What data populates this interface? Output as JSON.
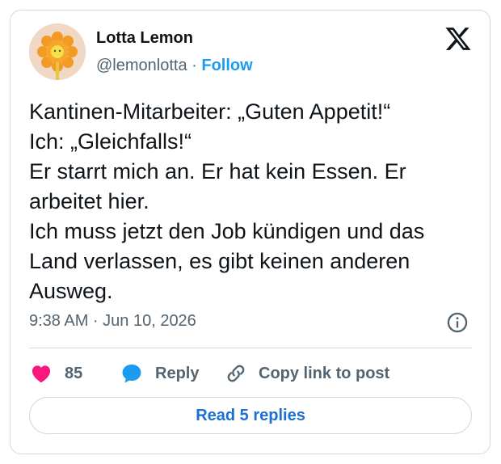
{
  "author": {
    "name": "Lotta Lemon",
    "handle": "@lemonlotta",
    "separator": "·",
    "follow_label": "Follow",
    "avatar_icon": "sun-flower-avatar"
  },
  "platform_icon": "x-logo-icon",
  "post": {
    "lines": [
      "Kantinen-Mitarbeiter: „Guten Appetit!“",
      "Ich: „Gleichfalls!“",
      "Er starrt mich an. Er hat kein Essen. Er",
      "arbeitet hier.",
      "Ich muss jetzt den Job kündigen und das",
      "Land verlassen, es gibt keinen anderen",
      "Ausweg."
    ],
    "timestamp": "9:38 AM · Jun 10, 2026",
    "info_icon": "info-icon"
  },
  "actions": {
    "like_count": "85",
    "reply_label": "Reply",
    "copy_label": "Copy link to post"
  },
  "read_replies_label": "Read 5 replies",
  "colors": {
    "accent": "#1d9bf0",
    "like": "#f91880",
    "reply_icon": "#1d9bf0",
    "muted_text": "#536471",
    "border": "#cfd9de"
  }
}
